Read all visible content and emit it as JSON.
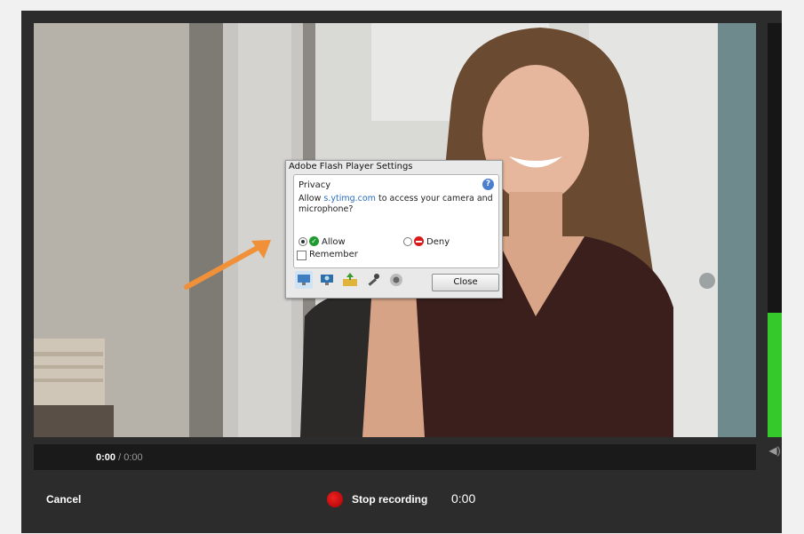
{
  "player": {
    "time_current": "0:00",
    "time_separator": " / ",
    "time_total": "0:00",
    "audio_level": 0.3
  },
  "controls": {
    "cancel_label": "Cancel",
    "stop_label": "Stop recording",
    "record_timer": "0:00"
  },
  "flash_dialog": {
    "title": "Adobe Flash Player Settings",
    "section": "Privacy",
    "message_prefix": "Allow ",
    "site_link": "s.ytimg.com",
    "message_suffix": " to access your camera and microphone?",
    "allow_label": "Allow",
    "deny_label": "Deny",
    "remember_label": "Remember",
    "close_label": "Close",
    "allow_selected": true,
    "tabs": [
      "display-tab-icon",
      "privacy-tab-icon",
      "storage-tab-icon",
      "microphone-tab-icon",
      "camera-tab-icon"
    ]
  },
  "colors": {
    "meter_green": "#35c92b",
    "record_red": "#dd1111",
    "arrow_orange": "#f0913a",
    "link_blue": "#2a6ebd"
  }
}
